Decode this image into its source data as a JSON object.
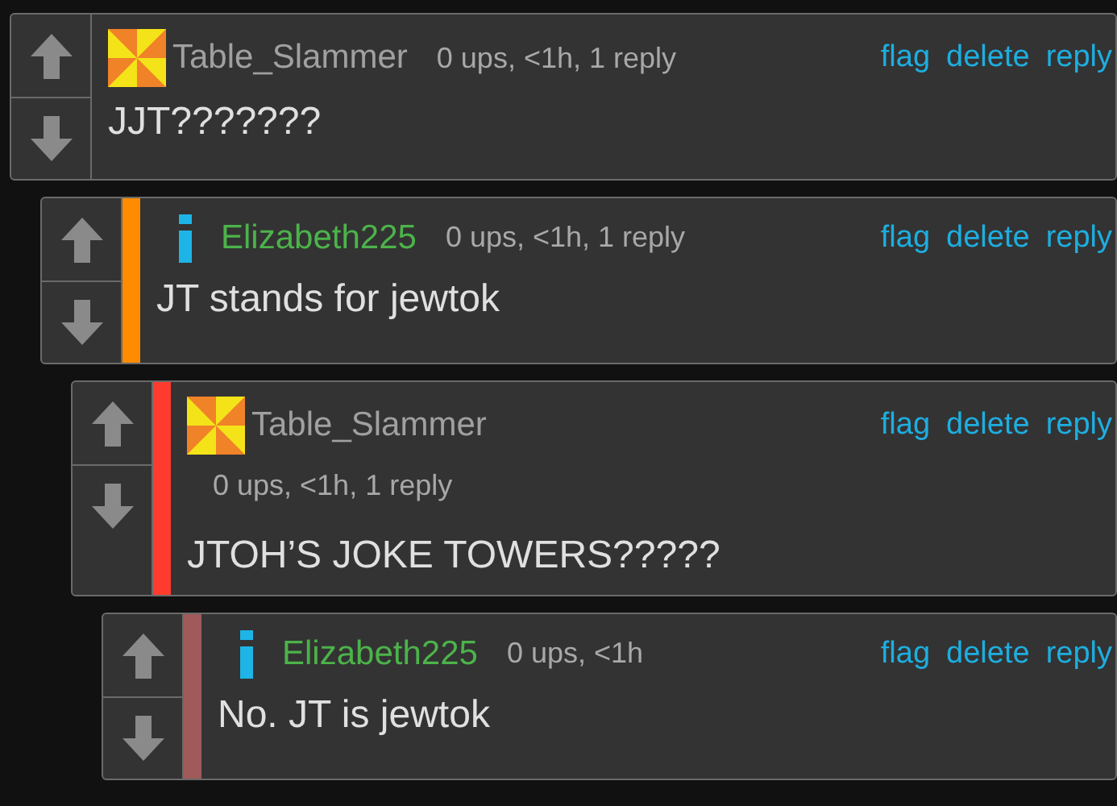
{
  "comments": [
    {
      "user": {
        "kind": "pinwheel",
        "name": "Table_Slammer",
        "color": "#a0a0a0"
      },
      "stats": "0 ups, <1h, 1 reply",
      "stats_on_own_line": false,
      "actions": [
        "flag",
        "delete",
        "reply"
      ],
      "text": "JJT???????",
      "children": [
        {
          "color": "#ff8c00",
          "user": {
            "kind": "info",
            "name": "Elizabeth225",
            "color": "#4cb34a"
          },
          "stats": "0 ups, <1h, 1 reply",
          "stats_on_own_line": false,
          "actions": [
            "flag",
            "delete",
            "reply"
          ],
          "text": "JT stands for jewtok",
          "children": [
            {
              "color": "#ff3b30",
              "user": {
                "kind": "pinwheel",
                "name": "Table_Slammer",
                "color": "#a0a0a0"
              },
              "stats": "0 ups, <1h, 1 reply",
              "stats_on_own_line": true,
              "actions": [
                "flag",
                "delete",
                "reply"
              ],
              "text": "JTOH’S JOKE TOWERS?????",
              "children": [
                {
                  "color": "#a05a5a",
                  "user": {
                    "kind": "info",
                    "name": "Elizabeth225",
                    "color": "#4cb34a"
                  },
                  "stats": "0 ups, <1h",
                  "stats_on_own_line": false,
                  "actions": [
                    "flag",
                    "delete",
                    "reply"
                  ],
                  "text": "No. JT is jewtok"
                }
              ]
            }
          ]
        }
      ]
    }
  ]
}
